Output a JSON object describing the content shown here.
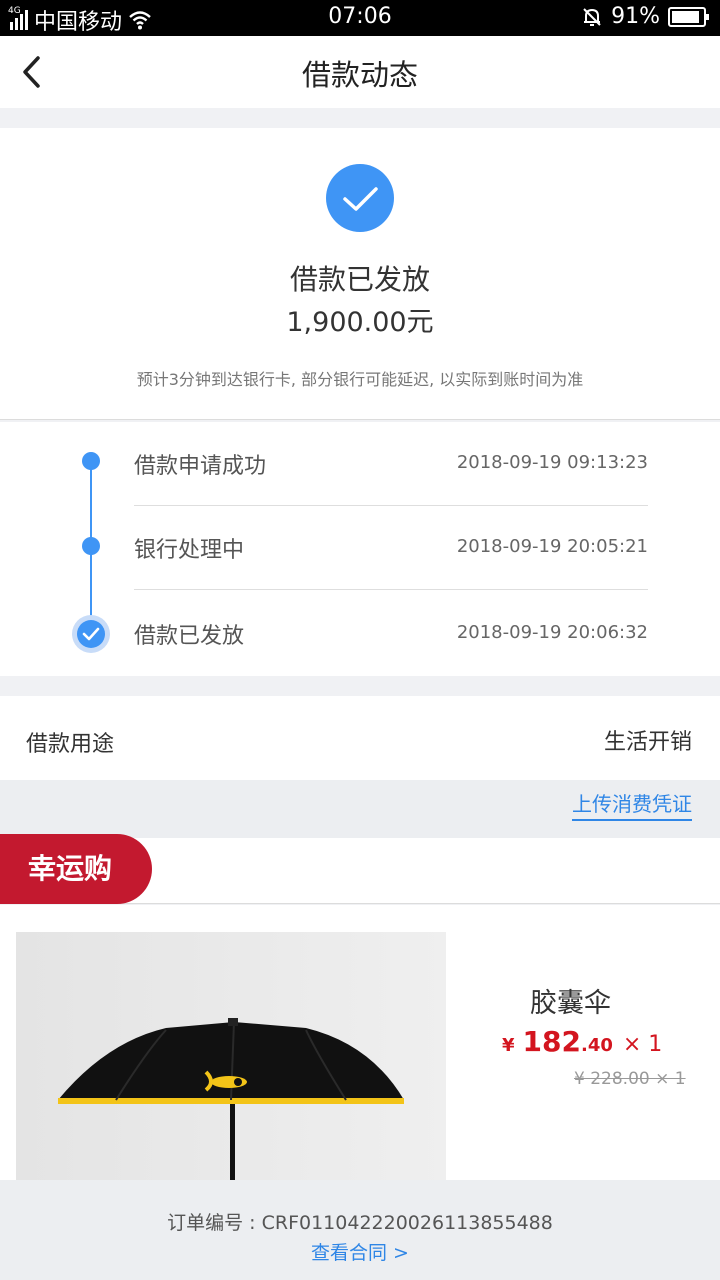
{
  "status_bar": {
    "network_tag": "4G",
    "carrier": "中国移动",
    "time": "07:06",
    "battery_text": "91%",
    "battery_level": 0.91,
    "icons": [
      "signal-icon",
      "wifi-icon",
      "mute-bell-icon",
      "battery-icon"
    ]
  },
  "header": {
    "title": "借款动态",
    "back_icon": "chevron-left-icon"
  },
  "loan_status": {
    "title": "借款已发放",
    "amount": "1,900.00元",
    "note": "预计3分钟到达银行卡, 部分银行可能延迟, 以实际到账时间为准",
    "icon": "check-circle-icon"
  },
  "timeline": [
    {
      "label": "借款申请成功",
      "time": "2018-09-19 09:13:23"
    },
    {
      "label": "银行处理中",
      "time": "2018-09-19 20:05:21"
    },
    {
      "label": "借款已发放",
      "time": "2018-09-19 20:06:32"
    }
  ],
  "purpose": {
    "label": "借款用途",
    "value": "生活开销"
  },
  "upload": {
    "link_text": "上传消费凭证"
  },
  "lucky_buy": {
    "tag": "幸运购",
    "product": {
      "name": "胶囊伞",
      "currency": "¥",
      "price_int": "182",
      "price_dec": ".40",
      "qty": "× 1",
      "old_price": "¥ 228.00 × 1",
      "image_icon": "umbrella-image"
    }
  },
  "footer": {
    "order_no": "订单编号 : CRF0110422200261138554​88",
    "contract_link": "查看合同 >"
  },
  "colors": {
    "accent_blue": "#3f95f5",
    "link_blue": "#2f86e6",
    "lucky_red": "#c3192f",
    "price_red": "#d3151f",
    "page_gray": "#f0f1f4"
  }
}
